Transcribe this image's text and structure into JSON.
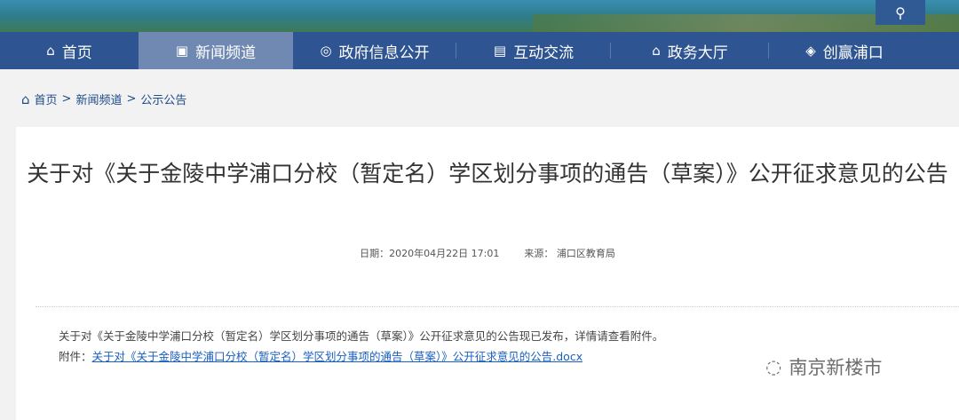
{
  "header": {
    "search_icon": "search-icon"
  },
  "nav": [
    {
      "label": "首页",
      "icon": "home-icon"
    },
    {
      "label": "新闻频道",
      "icon": "news-icon",
      "active": true
    },
    {
      "label": "政府信息公开",
      "icon": "signal-icon"
    },
    {
      "label": "互动交流",
      "icon": "chat-icon"
    },
    {
      "label": "政务大厅",
      "icon": "building-icon"
    },
    {
      "label": "创赢浦口",
      "icon": "handshake-icon"
    }
  ],
  "breadcrumb": {
    "items": [
      "首页",
      "新闻频道",
      "公示公告"
    ],
    "sep": ">"
  },
  "article": {
    "title": "关于对《关于金陵中学浦口分校（暂定名）学区划分事项的通告（草案）》公开征求意见的公告",
    "date": "日期：2020年04月22日 17:01",
    "source": "来源： 浦口区教育局",
    "body": "关于对《关于金陵中学浦口分校（暂定名）学区划分事项的通告（草案）》公开征求意见的公告现已发布，详情请查看附件。",
    "attachment_label": "附件：",
    "attachment_link": "关于对《关于金陵中学浦口分校（暂定名）学区划分事项的通告（草案）》公开征求意见的公告.docx"
  },
  "watermark": "南京新楼市"
}
